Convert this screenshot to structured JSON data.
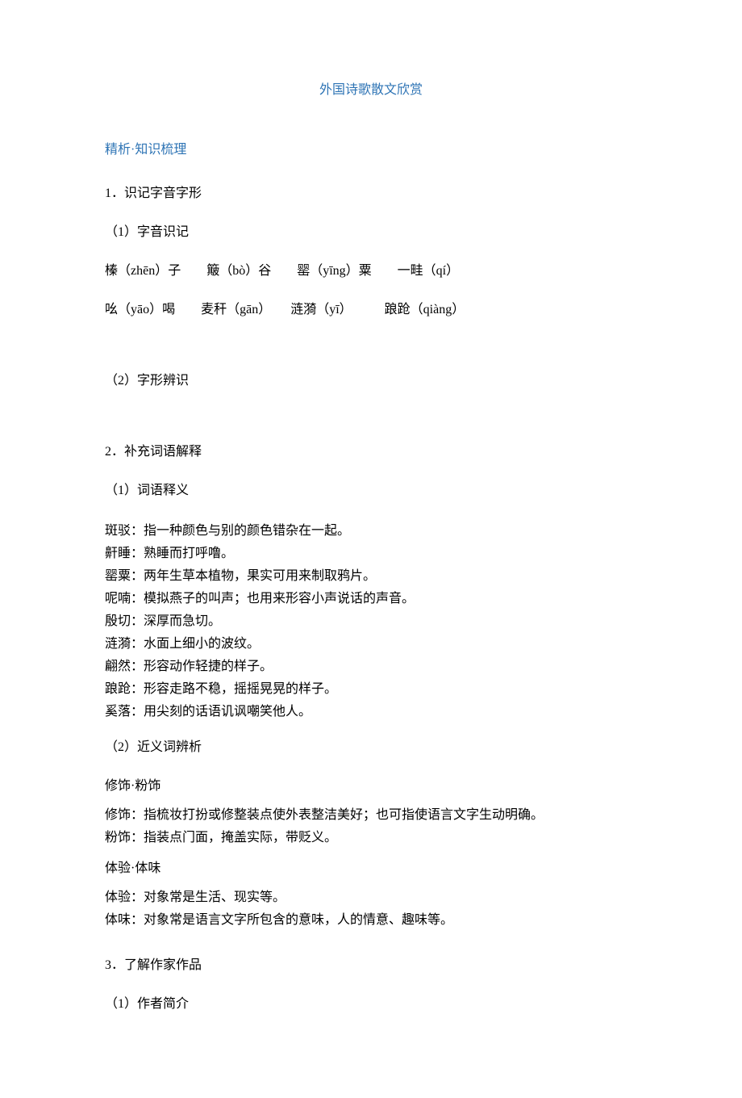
{
  "title": "外国诗歌散文欣赏",
  "section_head": "精析·知识梳理",
  "s1": {
    "head": "1．识记字音字形",
    "sub1": "（1）字音识记",
    "line1": "榛（zhēn）子　　簸（bò）谷　　罂（yīng）粟　　一畦（qí）",
    "line2": "吆（yāo）喝　　麦秆（gān）　　涟漪（yī）　　　踉跄（qiàng）",
    "sub2": "（2）字形辨识"
  },
  "s2": {
    "head": "2．补充词语解释",
    "sub1": "（1）词语释义",
    "defs": [
      "斑驳：指一种颜色与别的颜色错杂在一起。",
      "鼾睡：熟睡而打呼噜。",
      "罂粟：两年生草本植物，果实可用来制取鸦片。",
      "呢喃：模拟燕子的叫声；也用来形容小声说话的声音。",
      "殷切：深厚而急切。",
      "涟漪：水面上细小的波纹。",
      "翩然：形容动作轻捷的样子。",
      "踉跄：形容走路不稳，摇摇晃晃的样子。",
      "奚落：用尖刻的话语讥讽嘲笑他人。"
    ],
    "sub2": "（2）近义词辨析",
    "pair1_head": "修饰·粉饰",
    "pair1_body": [
      "修饰：指梳妆打扮或修整装点使外表整洁美好；也可指使语言文字生动明确。",
      "粉饰：指装点门面，掩盖实际，带贬义。"
    ],
    "pair2_head": "体验·体味",
    "pair2_body": [
      "体验：对象常是生活、现实等。",
      "体味：对象常是语言文字所包含的意味，人的情意、趣味等。"
    ]
  },
  "s3": {
    "head": "3．了解作家作品",
    "sub1": "（1）作者简介"
  }
}
